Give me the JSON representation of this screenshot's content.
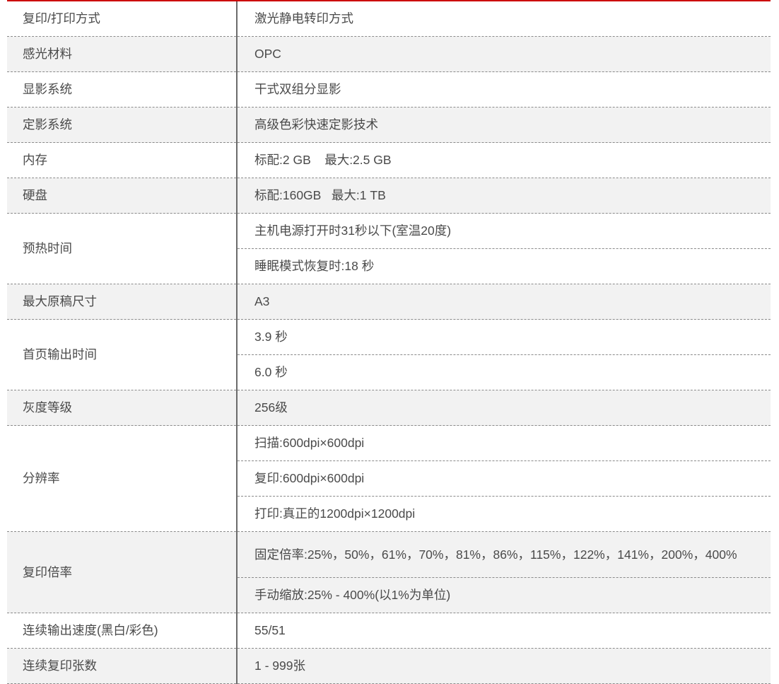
{
  "specs": [
    {
      "label": "复印/打印方式",
      "values": [
        "激光静电转印方式"
      ]
    },
    {
      "label": "感光材料",
      "values": [
        "OPC"
      ]
    },
    {
      "label": "显影系统",
      "values": [
        "干式双组分显影"
      ]
    },
    {
      "label": "定影系统",
      "values": [
        "高级色彩快速定影技术"
      ]
    },
    {
      "label": "内存",
      "values": [
        "标配:2 GB    最大:2.5 GB"
      ]
    },
    {
      "label": "硬盘",
      "values": [
        "标配:160GB   最大:1 TB"
      ]
    },
    {
      "label": "预热时间",
      "values": [
        "主机电源打开时31秒以下(室温20度)",
        "睡眠模式恢复时:18 秒"
      ]
    },
    {
      "label": "最大原稿尺寸",
      "values": [
        "A3"
      ]
    },
    {
      "label": "首页输出时间",
      "values": [
        "3.9 秒",
        "6.0 秒"
      ]
    },
    {
      "label": "灰度等级",
      "values": [
        "256级"
      ]
    },
    {
      "label": "分辨率",
      "values": [
        "扫描:600dpi×600dpi",
        "复印:600dpi×600dpi",
        "打印:真正的1200dpi×1200dpi"
      ]
    },
    {
      "label": "复印倍率",
      "values": [
        "固定倍率:25%，50%，61%，70%，81%，86%，115%，122%，141%，200%，400%",
        "手动缩放:25% - 400%(以1%为单位)"
      ]
    },
    {
      "label": "连续输出速度(黑白/彩色)",
      "values": [
        "55/51"
      ]
    },
    {
      "label": "连续复印张数",
      "values": [
        "1 - 999张"
      ]
    }
  ]
}
